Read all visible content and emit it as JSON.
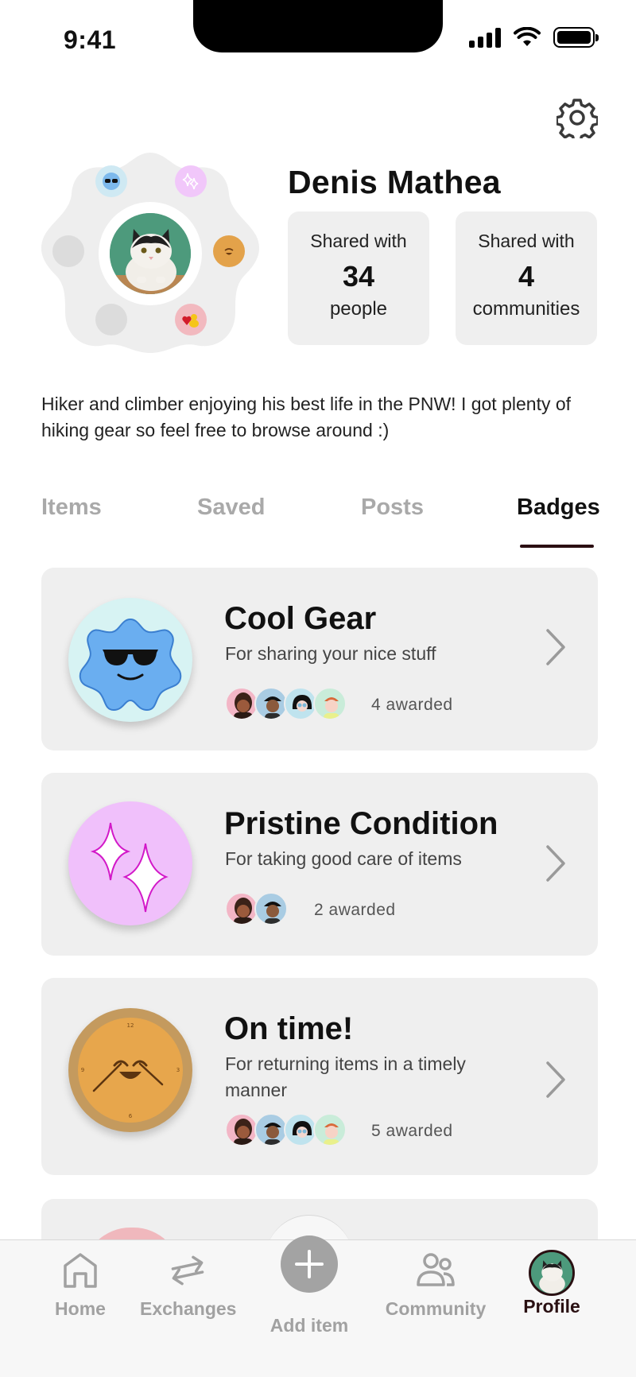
{
  "status_bar": {
    "time": "9:41"
  },
  "profile": {
    "name": "Denis Mathea",
    "stats": [
      {
        "label": "Shared with",
        "value": "34",
        "unit": "people"
      },
      {
        "label": "Shared with",
        "value": "4",
        "unit": "communities"
      }
    ],
    "bio": "Hiker and climber enjoying his best life in the PNW! I got plenty of hiking gear so feel free to browse around :)"
  },
  "tabs": [
    {
      "label": "Items",
      "active": false
    },
    {
      "label": "Saved",
      "active": false
    },
    {
      "label": "Posts",
      "active": false
    },
    {
      "label": "Badges",
      "active": true
    }
  ],
  "badges": [
    {
      "title": "Cool Gear",
      "description": "For sharing your nice stuff",
      "awarded": "4 awarded",
      "icon": "cool-gear-badge-icon",
      "color": "#5aa6ee"
    },
    {
      "title": "Pristine Condition",
      "description": "For taking good care of items",
      "awarded": "2 awarded",
      "icon": "sparkles-badge-icon",
      "color": "#f2c2fb"
    },
    {
      "title": "On time!",
      "description": "For returning items in a timely manner",
      "awarded": "5 awarded",
      "icon": "clock-badge-icon",
      "color": "#e3a24a"
    }
  ],
  "bottom_nav": [
    {
      "label": "Home",
      "icon": "home-icon",
      "active": false
    },
    {
      "label": "Exchanges",
      "icon": "exchange-arrows-icon",
      "active": false
    },
    {
      "label": "Add item",
      "icon": "plus-icon",
      "active": false
    },
    {
      "label": "Community",
      "icon": "people-icon",
      "active": false
    },
    {
      "label": "Profile",
      "icon": "profile-avatar-icon",
      "active": true
    }
  ],
  "colors": {
    "active_text": "#2a1012",
    "inactive_text": "#a1a1a1",
    "card_bg": "#efefef"
  }
}
